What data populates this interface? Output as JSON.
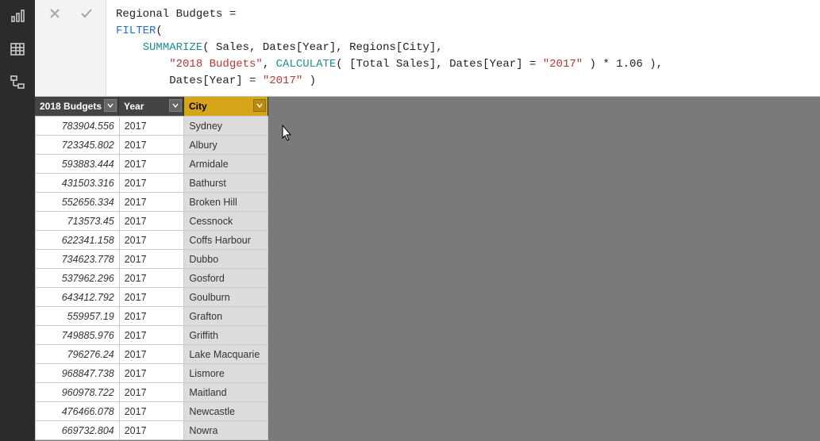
{
  "sidebar": {
    "icons": [
      "report-icon",
      "data-icon",
      "model-icon"
    ]
  },
  "formula_controls": {
    "cancel": "✕",
    "commit": "✓"
  },
  "dax": {
    "line1_name": "Regional Budgets",
    "eq": " =",
    "line2_filter": "FILTER",
    "line2_open": "(",
    "line3_indent": "    ",
    "line3_summarize": "SUMMARIZE",
    "line3_args": "( Sales, Dates[Year], Regions[City],",
    "line4_indent": "        ",
    "line4_str": "\"2018 Budgets\"",
    "line4_mid": ", ",
    "line4_calc": "CALCULATE",
    "line4_args1": "( [Total Sales], Dates[Year] = ",
    "line4_str2": "\"2017\"",
    "line4_tail": " ) * 1.06 ),",
    "line5_indent": "        ",
    "line5_pre": "Dates[Year] = ",
    "line5_str": "\"2017\"",
    "line5_tail": " )"
  },
  "table": {
    "headers": {
      "budget": "2018 Budgets",
      "year": "Year",
      "city": "City"
    },
    "rows": [
      {
        "budget": "783904.556",
        "year": "2017",
        "city": "Sydney"
      },
      {
        "budget": "723345.802",
        "year": "2017",
        "city": "Albury"
      },
      {
        "budget": "593883.444",
        "year": "2017",
        "city": "Armidale"
      },
      {
        "budget": "431503.316",
        "year": "2017",
        "city": "Bathurst"
      },
      {
        "budget": "552656.334",
        "year": "2017",
        "city": "Broken Hill"
      },
      {
        "budget": "713573.45",
        "year": "2017",
        "city": "Cessnock"
      },
      {
        "budget": "622341.158",
        "year": "2017",
        "city": "Coffs Harbour"
      },
      {
        "budget": "734623.778",
        "year": "2017",
        "city": "Dubbo"
      },
      {
        "budget": "537962.296",
        "year": "2017",
        "city": "Gosford"
      },
      {
        "budget": "643412.792",
        "year": "2017",
        "city": "Goulburn"
      },
      {
        "budget": "559957.19",
        "year": "2017",
        "city": "Grafton"
      },
      {
        "budget": "749885.976",
        "year": "2017",
        "city": "Griffith"
      },
      {
        "budget": "796276.24",
        "year": "2017",
        "city": "Lake Macquarie"
      },
      {
        "budget": "968847.738",
        "year": "2017",
        "city": "Lismore"
      },
      {
        "budget": "960978.722",
        "year": "2017",
        "city": "Maitland"
      },
      {
        "budget": "476466.078",
        "year": "2017",
        "city": "Newcastle"
      },
      {
        "budget": "669732.804",
        "year": "2017",
        "city": "Nowra"
      }
    ]
  }
}
